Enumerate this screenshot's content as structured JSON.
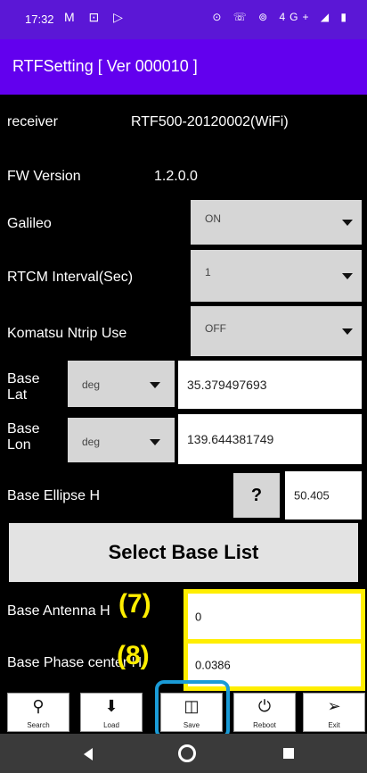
{
  "status_bar": {
    "time": "17:32",
    "left_icons": [
      "mail-icon",
      "message-icon",
      "play-icon"
    ],
    "right_icons": [
      "location-icon",
      "call-icon",
      "wifi-calling-icon",
      "4g-icon",
      "signal-icon",
      "battery-icon"
    ],
    "left_glyphs": "M ⊡ ▷",
    "right_glyphs": "⊙ ☏ ⊚ 4G+ ◢ ▮"
  },
  "app": {
    "title": "RTFSetting [ Ver 000010 ]"
  },
  "receiver": {
    "label": "receiver",
    "value": "RTF500-20120002(WiFi)"
  },
  "fw_version": {
    "label": "FW Version",
    "value": "1.2.0.0"
  },
  "galileo": {
    "label": "Galileo",
    "selected": "ON"
  },
  "rtcm_interval": {
    "label": "RTCM Interval(Sec)",
    "selected": "1"
  },
  "komatsu_ntrip": {
    "label": "Komatsu Ntrip Use",
    "selected": "OFF"
  },
  "base_lat": {
    "label": "Base\nLat",
    "unit": "deg",
    "value": "35.379497693"
  },
  "base_lon": {
    "label": "Base\nLon",
    "unit": "deg",
    "value": "139.644381749"
  },
  "base_ellipse": {
    "label": "Base Ellipse H",
    "help": "?",
    "value": "50.405"
  },
  "select_base_list": {
    "label": "Select Base List"
  },
  "base_antenna": {
    "label": "Base Antenna H",
    "value": "0",
    "annotation": "(7)"
  },
  "base_phase": {
    "label": "Base Phase center H",
    "value": "0.0386",
    "annotation": "(8)"
  },
  "toolbar": {
    "search": "Search",
    "load": "Load",
    "save": "Save",
    "reboot": "Reboot",
    "exit": "Exit"
  },
  "colors": {
    "status": "#5b17d6",
    "appbar": "#6200ee",
    "highlight": "#ffee00",
    "focus": "#1a9bd7"
  }
}
